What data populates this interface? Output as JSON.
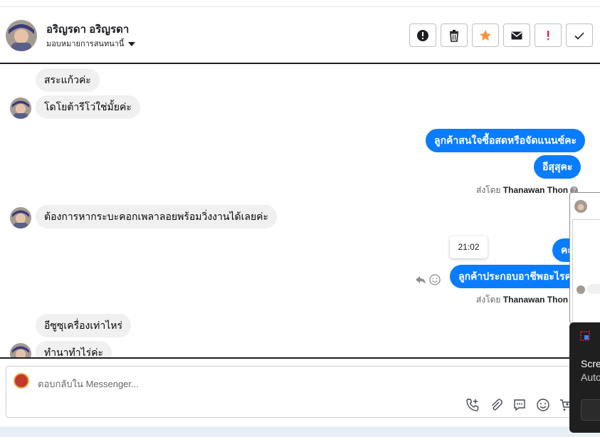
{
  "header": {
    "name": "อริญรดา อริญรดา",
    "assign_label": "มอบหมายการสนทนานี้",
    "actions": [
      {
        "icon": "alert-circle-icon",
        "name": "mark-spam-button"
      },
      {
        "icon": "trash-icon",
        "name": "delete-button"
      },
      {
        "icon": "star-icon",
        "name": "star-button"
      },
      {
        "icon": "envelope-icon",
        "name": "mark-unread-button"
      },
      {
        "icon": "exclamation-icon",
        "name": "follow-up-button"
      },
      {
        "icon": "check-icon",
        "name": "mark-done-button"
      }
    ]
  },
  "thread": {
    "m1": "สระแก้วค่ะ",
    "m2": "โดโยต้ารีโว่ใช่มั้ยค่ะ",
    "m3": "ลูกค้าสนใจซื้อสดหรือจัดแนนซ์คะ",
    "m4": "อีสุสุคะ",
    "sent_by_1_prefix": "ส่งโดย",
    "sent_by_1_name": "Thanawan Thon",
    "m5": "ต้องการหากระบะคอกเพลาลอยพร้อมวิ่งงานได้เลยค่ะ",
    "tooltip_time": "21:02",
    "m6": "คะ",
    "m7": "ลูกค้าประกอบอาชีพอะไรคะ",
    "sent_by_2_prefix": "ส่งโดย",
    "sent_by_2_name": "Thanawan Thon",
    "m8": "อีซูซุเครื่องเท่าไหร่",
    "m9": "ทำนาทำไร่ค่ะ"
  },
  "composer": {
    "placeholder": "ตอบกลับใน Messenger..."
  },
  "toast": {
    "title": "Scre",
    "subtitle": "Auto"
  },
  "colors": {
    "outgoing_bubble": "#0a7cff",
    "incoming_bubble": "#f0f0f0",
    "star": "#f7923b",
    "follow_up": "#e41e3f"
  }
}
